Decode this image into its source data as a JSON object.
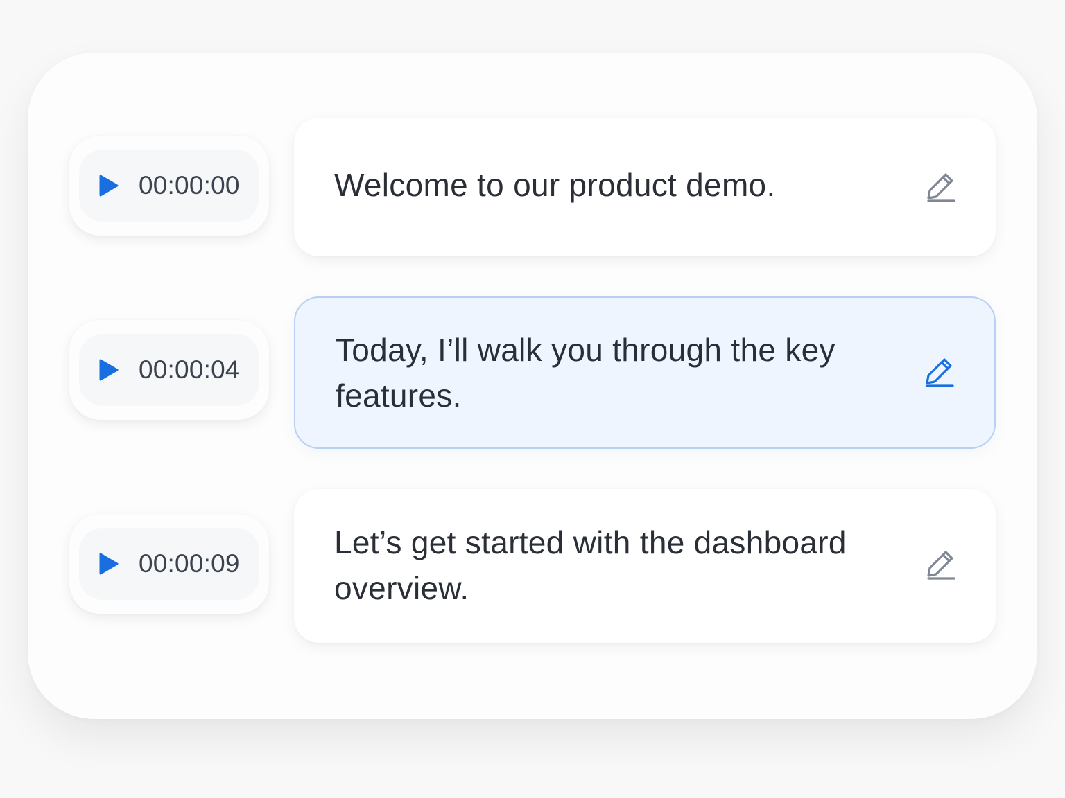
{
  "segments": [
    {
      "timestamp": "00:00:00",
      "text": "Welcome to our product demo.",
      "active": false,
      "play_icon": "play-icon",
      "edit_icon": "pencil-icon"
    },
    {
      "timestamp": "00:00:04",
      "text": "Today, I’ll walk you through the key features.",
      "active": true,
      "play_icon": "play-icon",
      "edit_icon": "pencil-icon"
    },
    {
      "timestamp": "00:00:09",
      "text": "Let’s get started with the dashboard overview.",
      "active": false,
      "play_icon": "play-icon",
      "edit_icon": "pencil-icon"
    }
  ],
  "colors": {
    "accent": "#1a6fe0",
    "active_card_bg": "#eef5fe",
    "active_card_border": "#b7d0f3",
    "icon_gray": "#7f8794",
    "text": "#2a2f37"
  }
}
